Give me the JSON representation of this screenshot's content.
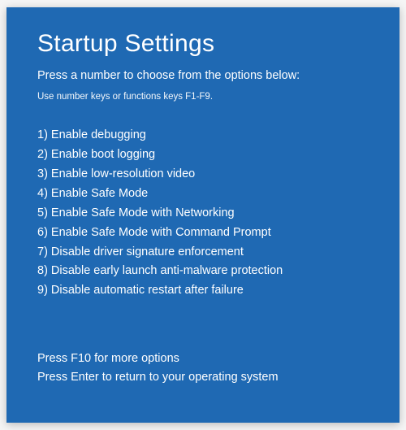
{
  "title": "Startup Settings",
  "subtitle": "Press a number to choose from the options below:",
  "hint": "Use number keys or functions keys F1-F9.",
  "options": [
    "1) Enable debugging",
    "2) Enable boot logging",
    "3) Enable low-resolution video",
    "4) Enable Safe Mode",
    "5) Enable Safe Mode with Networking",
    "6) Enable Safe Mode with Command Prompt",
    "7) Disable driver signature enforcement",
    "8) Disable early launch anti-malware protection",
    "9) Disable automatic restart after failure"
  ],
  "footer": {
    "more": "Press F10 for more options",
    "return": "Press Enter to return to your operating system"
  }
}
